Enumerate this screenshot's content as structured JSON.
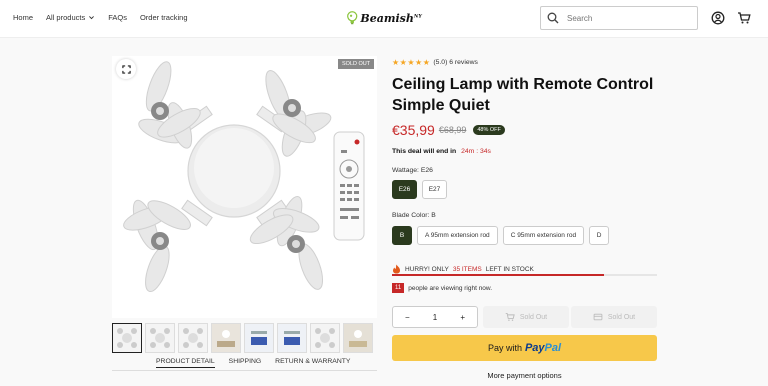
{
  "nav": {
    "items": [
      "Home",
      "All products",
      "FAQs",
      "Order tracking"
    ]
  },
  "logo": {
    "text": "Beamish",
    "sup": "NY"
  },
  "search": {
    "placeholder": "Search"
  },
  "gallery": {
    "soldout_label": "SOLD OUT",
    "thumb_count": 8
  },
  "tabs": [
    "PRODUCT DETAIL",
    "SHIPPING",
    "RETURN & WARRANTY"
  ],
  "product": {
    "rating_stars": 5,
    "rating_text": "(5.0) 6 reviews",
    "title": "Ceiling Lamp with Remote Control Simple Quiet",
    "price": "€35,99",
    "old_price": "€68,99",
    "off_badge": "48% OFF",
    "deal_label": "This deal will end in",
    "deal_timer": "24m : 34s",
    "wattage_label": "Wattage: E26",
    "wattage_options": [
      "E26",
      "E27"
    ],
    "blade_label": "Blade Color: B",
    "blade_options": [
      "B",
      "A 95mm extension rod",
      "C 95mm extension rod",
      "D"
    ],
    "hurry_prefix": "HURRY! ONLY",
    "hurry_count": "35 ITEMS",
    "hurry_suffix": "LEFT IN STOCK",
    "stock_fraction": 0.8,
    "viewers": "11",
    "viewers_text": "people are viewing right now.",
    "qty_minus": "−",
    "qty_value": "1",
    "qty_plus": "+",
    "sold_out_label": "Sold Out",
    "paypal_prefix": "Pay with",
    "paypal_brand_1": "Pay",
    "paypal_brand_2": "Pal",
    "more_payment": "More payment options"
  },
  "colors": {
    "accent": "#2b3a1e",
    "sale": "#c62828",
    "paypal": "#f7c84a"
  }
}
